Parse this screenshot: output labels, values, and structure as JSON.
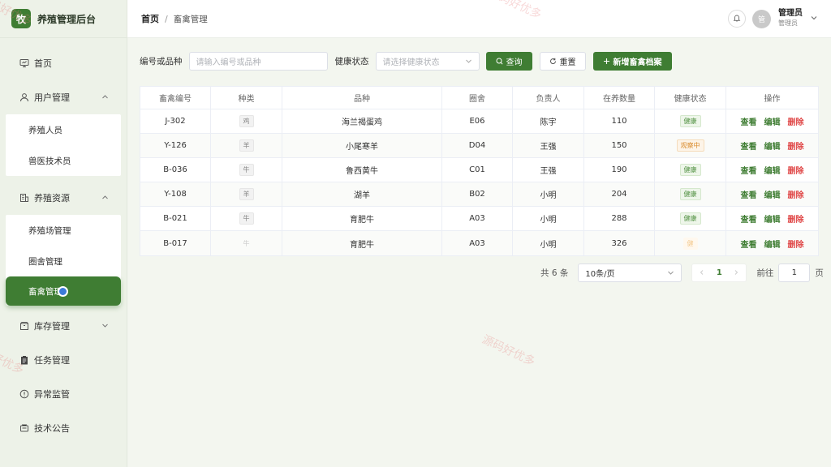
{
  "brand": {
    "logo_char": "牧",
    "name": "养殖管理后台"
  },
  "sidebar": {
    "items": [
      {
        "label": "首页",
        "icon": "monitor-icon"
      },
      {
        "label": "用户管理",
        "icon": "user-icon",
        "children": [
          "养殖人员",
          "兽医技术员"
        ]
      },
      {
        "label": "养殖资源",
        "icon": "building-icon",
        "children": [
          "养殖场管理",
          "圈舍管理",
          "畜禽管理"
        ]
      },
      {
        "label": "库存管理",
        "icon": "box-icon"
      },
      {
        "label": "任务管理",
        "icon": "clipboard-icon"
      },
      {
        "label": "异常监管",
        "icon": "warning-circle-icon"
      },
      {
        "label": "技术公告",
        "icon": "notice-icon"
      }
    ]
  },
  "header": {
    "crumb_home": "首页",
    "crumb_sep": "/",
    "crumb_current": "畜禽管理",
    "avatar_char": "管",
    "user_name": "管理员",
    "user_role": "管理员"
  },
  "filter": {
    "code_label": "编号或品种",
    "code_placeholder": "请输入编号或品种",
    "health_label": "健康状态",
    "health_placeholder": "请选择健康状态",
    "search_label": "查询",
    "reset_label": "重置",
    "add_label": "新增畜禽档案"
  },
  "table": {
    "columns": [
      "畜禽编号",
      "种类",
      "品种",
      "圈舍",
      "负责人",
      "在养数量",
      "健康状态",
      "操作"
    ],
    "rows": [
      {
        "code": "J-302",
        "type": "鸡",
        "breed": "海兰褐蛋鸡",
        "pen": "E06",
        "owner": "陈宇",
        "count": "110",
        "health": "健康",
        "health_style": "good"
      },
      {
        "code": "Y-126",
        "type": "羊",
        "breed": "小尾寒羊",
        "pen": "D04",
        "owner": "王强",
        "count": "150",
        "health": "观察中",
        "health_style": "watch"
      },
      {
        "code": "B-036",
        "type": "牛",
        "breed": "鲁西黄牛",
        "pen": "C01",
        "owner": "王强",
        "count": "190",
        "health": "健康",
        "health_style": "good"
      },
      {
        "code": "Y-108",
        "type": "羊",
        "breed": "湖羊",
        "pen": "B02",
        "owner": "小明",
        "count": "204",
        "health": "健康",
        "health_style": "good"
      },
      {
        "code": "B-021",
        "type": "牛",
        "breed": "育肥牛",
        "pen": "A03",
        "owner": "小明",
        "count": "288",
        "health": "健康",
        "health_style": "good"
      },
      {
        "code": "B-017",
        "type": "牛",
        "breed": "育肥牛",
        "pen": "A03",
        "owner": "小明",
        "count": "326",
        "health": "健",
        "health_style": "faint"
      }
    ],
    "actions": {
      "view": "查看",
      "edit": "编辑",
      "delete": "删除"
    }
  },
  "pagination": {
    "total_text": "共 6 条",
    "page_size": "10条/页",
    "current_page": "1",
    "goto_label": "前往",
    "goto_value": "1",
    "page_suffix": "页"
  },
  "watermark": "源码好优多",
  "colors": {
    "primary": "#3f7d33",
    "danger": "#e04848",
    "warning": "#d98a2b"
  }
}
